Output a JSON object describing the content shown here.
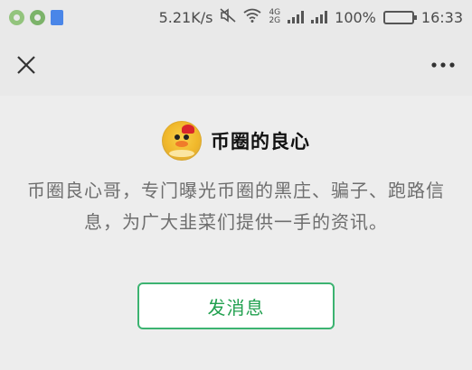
{
  "status_bar": {
    "network_speed": "5.21K/s",
    "network_tag_top": "4G",
    "network_tag_bottom": "2G",
    "battery": "100%",
    "time": "16:33"
  },
  "nav": {
    "close_icon": "close-icon",
    "more_icon": "more-icon"
  },
  "profile": {
    "name": "币圈的良心",
    "description": "币圈良心哥，专门曝光币圈的黑庄、骗子、跑路信息，为广大韭菜们提供一手的资讯。",
    "send_message_label": "发消息"
  },
  "colors": {
    "accent": "#21a04f",
    "background": "#ededed",
    "text_secondary": "#6e6e6e"
  }
}
